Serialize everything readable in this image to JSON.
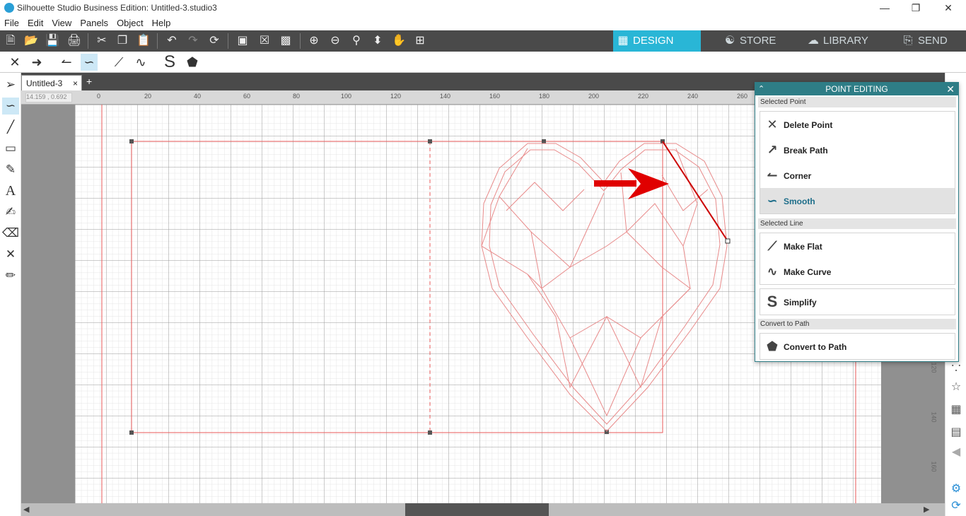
{
  "window": {
    "title": "Silhouette Studio Business Edition: Untitled-3.studio3"
  },
  "menu": {
    "items": [
      "File",
      "Edit",
      "View",
      "Panels",
      "Object",
      "Help"
    ]
  },
  "nav_tabs": [
    {
      "label": "DESIGN",
      "icon": "grid-icon",
      "active": true
    },
    {
      "label": "STORE",
      "icon": "silhouette-s-icon",
      "active": false
    },
    {
      "label": "LIBRARY",
      "icon": "cloud-icon",
      "active": false
    },
    {
      "label": "SEND",
      "icon": "cutter-icon",
      "active": false
    }
  ],
  "document": {
    "tab_label": "Untitled-3",
    "tab_close": "×",
    "add_tab": "+"
  },
  "ruler": {
    "coords_readout": "14.159 , 0.692",
    "top_ticks": [
      "0",
      "20",
      "40",
      "60",
      "80",
      "100",
      "120",
      "140",
      "160",
      "180",
      "200",
      "220",
      "240",
      "260"
    ],
    "right_ticks": [
      "120",
      "140",
      "160"
    ]
  },
  "panel": {
    "title": "POINT EDITING",
    "sections": {
      "selected_point": "Selected Point",
      "selected_line": "Selected Line",
      "convert": "Convert to Path"
    },
    "point_actions": [
      {
        "label": "Delete Point",
        "icon": "delete-point-icon",
        "active": false
      },
      {
        "label": "Break Path",
        "icon": "break-path-icon",
        "active": false
      },
      {
        "label": "Corner",
        "icon": "corner-icon",
        "active": false
      },
      {
        "label": "Smooth",
        "icon": "smooth-icon",
        "active": true
      }
    ],
    "line_actions": [
      {
        "label": "Make Flat",
        "icon": "make-flat-icon"
      },
      {
        "label": "Make Curve",
        "icon": "make-curve-icon"
      }
    ],
    "simplify_label": "Simplify",
    "convert_label": "Convert to Path"
  },
  "colors": {
    "accent": "#2e7d86",
    "design_tab": "#29b6d6",
    "cut_line": "#e85a5a",
    "arrow": "#e00000"
  }
}
